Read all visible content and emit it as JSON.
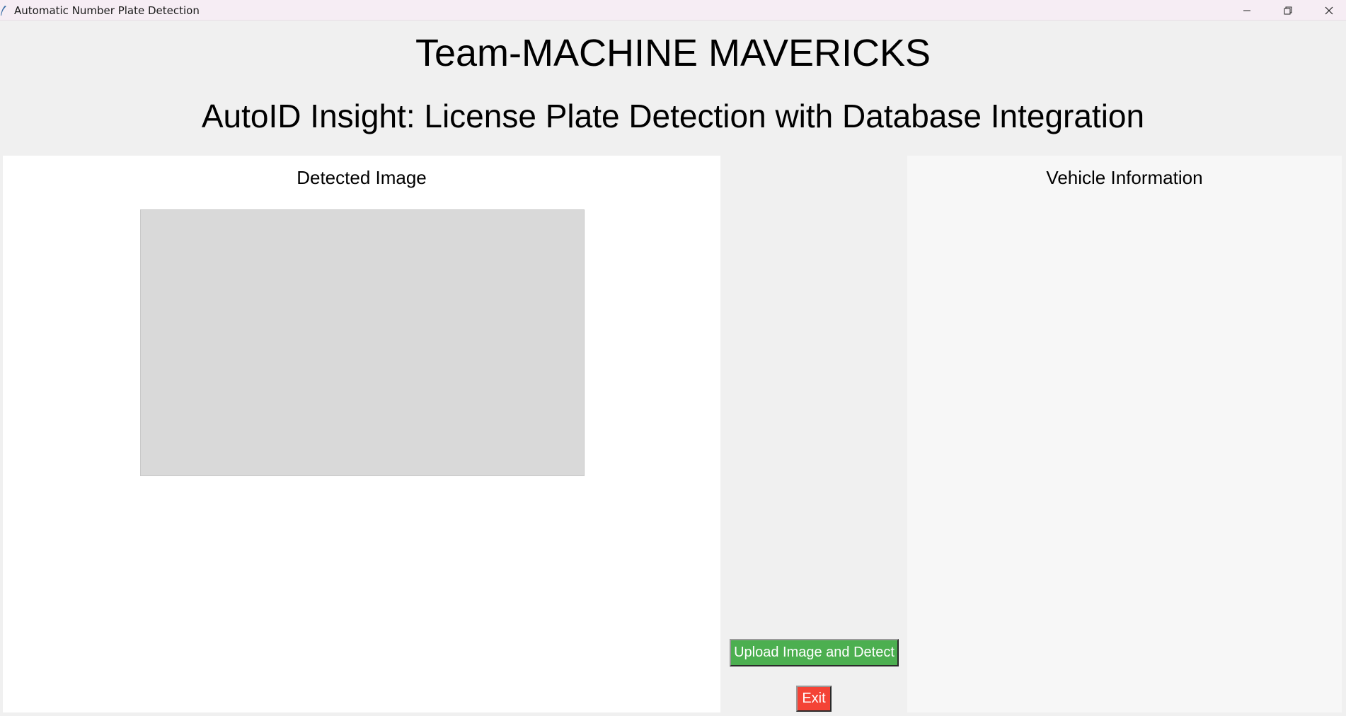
{
  "window": {
    "title": "Automatic Number Plate Detection",
    "controls": {
      "minimize_icon": "minimize-icon",
      "maximize_icon": "restore-icon",
      "close_icon": "close-icon"
    }
  },
  "header": {
    "team": "Team-MACHINE MAVERICKS",
    "subtitle": "AutoID Insight: License Plate Detection with Database Integration"
  },
  "left_panel": {
    "title": "Detected Image"
  },
  "right_panel": {
    "title": "Vehicle Information"
  },
  "actions": {
    "upload_label": "Upload Image and Detect",
    "exit_label": "Exit"
  },
  "colors": {
    "upload_button": "#4caf50",
    "exit_button": "#f44336",
    "image_placeholder": "#d9d9d9"
  }
}
